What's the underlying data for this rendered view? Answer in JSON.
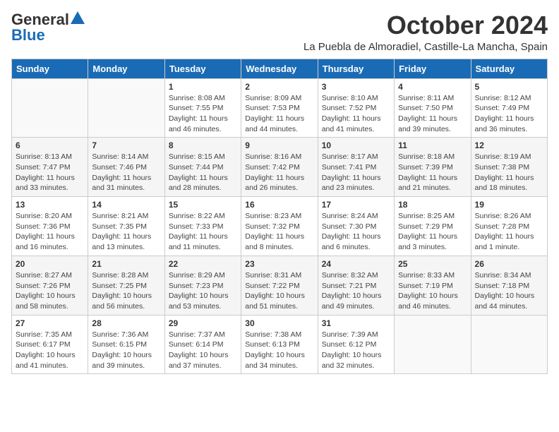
{
  "header": {
    "logo_general": "General",
    "logo_blue": "Blue",
    "month": "October 2024",
    "location": "La Puebla de Almoradiel, Castille-La Mancha, Spain"
  },
  "days_of_week": [
    "Sunday",
    "Monday",
    "Tuesday",
    "Wednesday",
    "Thursday",
    "Friday",
    "Saturday"
  ],
  "weeks": [
    [
      {
        "day": "",
        "info": ""
      },
      {
        "day": "",
        "info": ""
      },
      {
        "day": "1",
        "info": "Sunrise: 8:08 AM\nSunset: 7:55 PM\nDaylight: 11 hours and 46 minutes."
      },
      {
        "day": "2",
        "info": "Sunrise: 8:09 AM\nSunset: 7:53 PM\nDaylight: 11 hours and 44 minutes."
      },
      {
        "day": "3",
        "info": "Sunrise: 8:10 AM\nSunset: 7:52 PM\nDaylight: 11 hours and 41 minutes."
      },
      {
        "day": "4",
        "info": "Sunrise: 8:11 AM\nSunset: 7:50 PM\nDaylight: 11 hours and 39 minutes."
      },
      {
        "day": "5",
        "info": "Sunrise: 8:12 AM\nSunset: 7:49 PM\nDaylight: 11 hours and 36 minutes."
      }
    ],
    [
      {
        "day": "6",
        "info": "Sunrise: 8:13 AM\nSunset: 7:47 PM\nDaylight: 11 hours and 33 minutes."
      },
      {
        "day": "7",
        "info": "Sunrise: 8:14 AM\nSunset: 7:46 PM\nDaylight: 11 hours and 31 minutes."
      },
      {
        "day": "8",
        "info": "Sunrise: 8:15 AM\nSunset: 7:44 PM\nDaylight: 11 hours and 28 minutes."
      },
      {
        "day": "9",
        "info": "Sunrise: 8:16 AM\nSunset: 7:42 PM\nDaylight: 11 hours and 26 minutes."
      },
      {
        "day": "10",
        "info": "Sunrise: 8:17 AM\nSunset: 7:41 PM\nDaylight: 11 hours and 23 minutes."
      },
      {
        "day": "11",
        "info": "Sunrise: 8:18 AM\nSunset: 7:39 PM\nDaylight: 11 hours and 21 minutes."
      },
      {
        "day": "12",
        "info": "Sunrise: 8:19 AM\nSunset: 7:38 PM\nDaylight: 11 hours and 18 minutes."
      }
    ],
    [
      {
        "day": "13",
        "info": "Sunrise: 8:20 AM\nSunset: 7:36 PM\nDaylight: 11 hours and 16 minutes."
      },
      {
        "day": "14",
        "info": "Sunrise: 8:21 AM\nSunset: 7:35 PM\nDaylight: 11 hours and 13 minutes."
      },
      {
        "day": "15",
        "info": "Sunrise: 8:22 AM\nSunset: 7:33 PM\nDaylight: 11 hours and 11 minutes."
      },
      {
        "day": "16",
        "info": "Sunrise: 8:23 AM\nSunset: 7:32 PM\nDaylight: 11 hours and 8 minutes."
      },
      {
        "day": "17",
        "info": "Sunrise: 8:24 AM\nSunset: 7:30 PM\nDaylight: 11 hours and 6 minutes."
      },
      {
        "day": "18",
        "info": "Sunrise: 8:25 AM\nSunset: 7:29 PM\nDaylight: 11 hours and 3 minutes."
      },
      {
        "day": "19",
        "info": "Sunrise: 8:26 AM\nSunset: 7:28 PM\nDaylight: 11 hours and 1 minute."
      }
    ],
    [
      {
        "day": "20",
        "info": "Sunrise: 8:27 AM\nSunset: 7:26 PM\nDaylight: 10 hours and 58 minutes."
      },
      {
        "day": "21",
        "info": "Sunrise: 8:28 AM\nSunset: 7:25 PM\nDaylight: 10 hours and 56 minutes."
      },
      {
        "day": "22",
        "info": "Sunrise: 8:29 AM\nSunset: 7:23 PM\nDaylight: 10 hours and 53 minutes."
      },
      {
        "day": "23",
        "info": "Sunrise: 8:31 AM\nSunset: 7:22 PM\nDaylight: 10 hours and 51 minutes."
      },
      {
        "day": "24",
        "info": "Sunrise: 8:32 AM\nSunset: 7:21 PM\nDaylight: 10 hours and 49 minutes."
      },
      {
        "day": "25",
        "info": "Sunrise: 8:33 AM\nSunset: 7:19 PM\nDaylight: 10 hours and 46 minutes."
      },
      {
        "day": "26",
        "info": "Sunrise: 8:34 AM\nSunset: 7:18 PM\nDaylight: 10 hours and 44 minutes."
      }
    ],
    [
      {
        "day": "27",
        "info": "Sunrise: 7:35 AM\nSunset: 6:17 PM\nDaylight: 10 hours and 41 minutes."
      },
      {
        "day": "28",
        "info": "Sunrise: 7:36 AM\nSunset: 6:15 PM\nDaylight: 10 hours and 39 minutes."
      },
      {
        "day": "29",
        "info": "Sunrise: 7:37 AM\nSunset: 6:14 PM\nDaylight: 10 hours and 37 minutes."
      },
      {
        "day": "30",
        "info": "Sunrise: 7:38 AM\nSunset: 6:13 PM\nDaylight: 10 hours and 34 minutes."
      },
      {
        "day": "31",
        "info": "Sunrise: 7:39 AM\nSunset: 6:12 PM\nDaylight: 10 hours and 32 minutes."
      },
      {
        "day": "",
        "info": ""
      },
      {
        "day": "",
        "info": ""
      }
    ]
  ]
}
